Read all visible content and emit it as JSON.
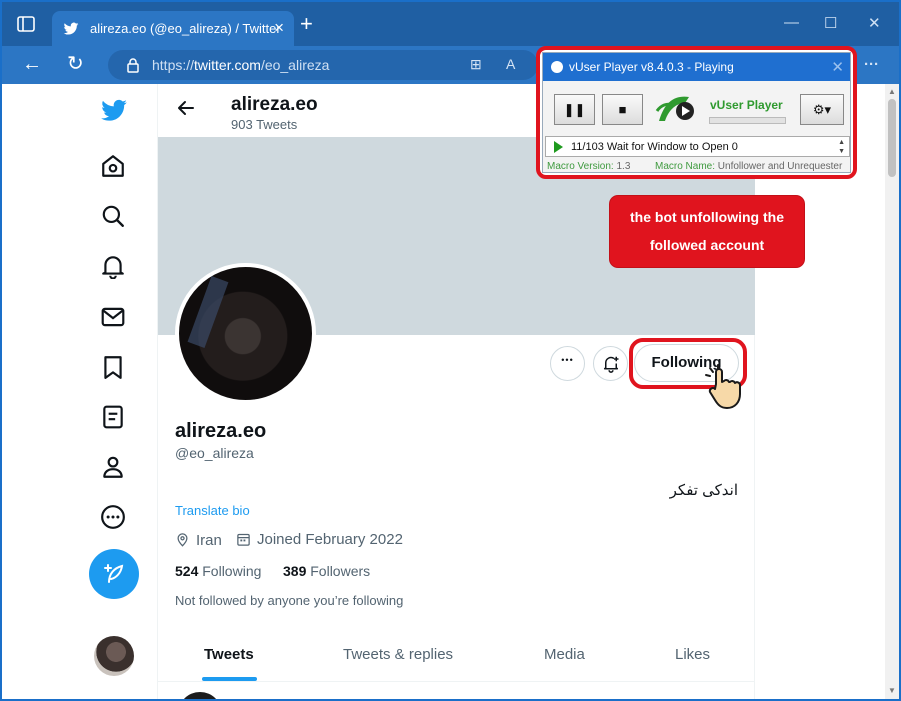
{
  "browser": {
    "tab_title": "alireza.eo (@eo_alireza) / Twitter",
    "new_tab_label": "+",
    "url_prefix": "https://",
    "url_host": "twitter.com",
    "url_path": "/eo_alireza",
    "more_label": "···"
  },
  "profile_header": {
    "name": "alireza.eo",
    "tweet_count": "903 Tweets"
  },
  "profile": {
    "display_name": "alireza.eo",
    "handle": "@eo_alireza",
    "bio": "اندکی تفکر",
    "translate_label": "Translate bio",
    "location": "Iran",
    "joined": "Joined February 2022",
    "following_count": "524",
    "following_label": "Following",
    "followers_count": "389",
    "followers_label": "Followers",
    "not_followed_text": "Not followed by anyone you’re following",
    "follow_button_label": "Following",
    "more_button_label": "•••"
  },
  "tabs": [
    {
      "label": "Tweets",
      "active": true
    },
    {
      "label": "Tweets & replies",
      "active": false
    },
    {
      "label": "Media",
      "active": false
    },
    {
      "label": "Likes",
      "active": false
    }
  ],
  "vuser_player": {
    "title": "vUser Player v8.4.0.3 - Playing",
    "logo_text": "vUser Player",
    "status": "11/103 Wait for Window to Open 0",
    "macro_version_label": "Macro Version:",
    "macro_version": "1.3",
    "macro_name_label": "Macro Name:",
    "macro_name": "Unfollower and Unrequester"
  },
  "callout": {
    "line1": "the bot unfollowing the",
    "line2": "followed account"
  },
  "colors": {
    "twitter_blue": "#1d9bf0",
    "browser_blue": "#1f5fa3",
    "annotation_red": "#e0141e",
    "vuser_green": "#2f9a2f"
  },
  "icons": [
    "twitter-logo-icon",
    "home-icon",
    "explore-icon",
    "notifications-icon",
    "messages-icon",
    "bookmarks-icon",
    "lists-icon",
    "profile-icon",
    "more-icon",
    "compose-icon"
  ]
}
